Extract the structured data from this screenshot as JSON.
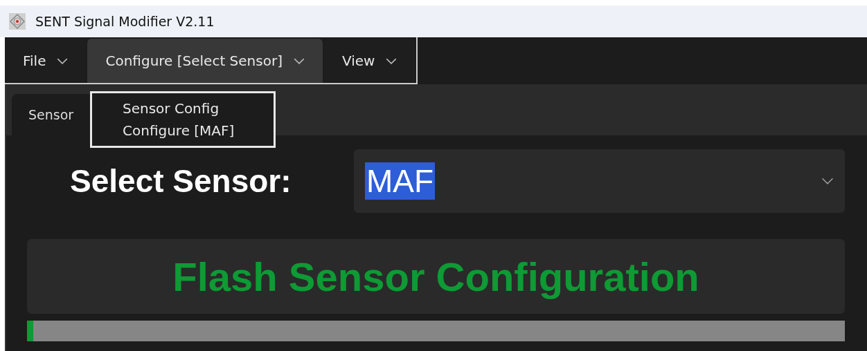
{
  "window": {
    "title": "SENT Signal Modifier V2.11"
  },
  "menu_bar": [
    {
      "label": "File",
      "expanded": false
    },
    {
      "label": "Configure [Select Sensor]",
      "expanded": true
    },
    {
      "label": "View",
      "expanded": false
    }
  ],
  "dropdown_menu": [
    "Sensor Config",
    "Configure [MAF]"
  ],
  "tabs": [
    {
      "label": "Sensor",
      "selected": true
    }
  ],
  "sensor_select": {
    "label": "Select Sensor:",
    "value": "MAF"
  },
  "flash_button": "Flash Sensor Configuration",
  "progress": {
    "level": 0.008
  }
}
